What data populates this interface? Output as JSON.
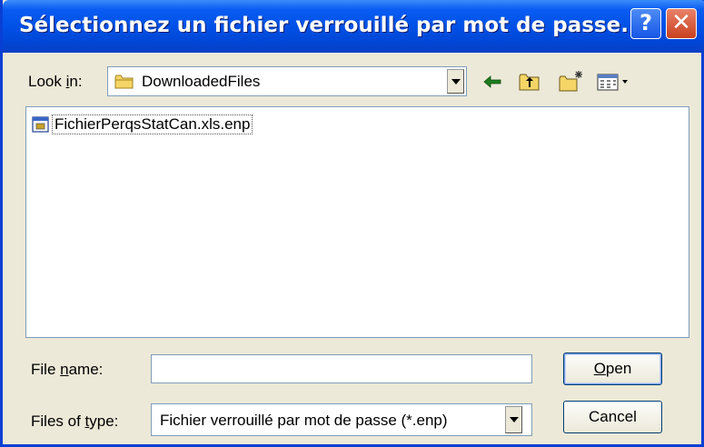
{
  "window": {
    "title": "Sélectionnez un fichier verrouillé par mot de passe.",
    "help_glyph": "?",
    "close_glyph": "✕"
  },
  "look_in": {
    "label": "Look in:",
    "mnemonic_prefix": "Look ",
    "mnemonic_char": "i",
    "mnemonic_suffix": "n:",
    "value": "DownloadedFiles",
    "icon": "folder-icon"
  },
  "toolbar": {
    "icons": [
      "back-arrow-icon",
      "up-one-level-icon",
      "new-folder-icon",
      "view-menu-icon"
    ]
  },
  "files": [
    {
      "name": "FichierPerqsStatCan.xls.enp",
      "icon": "encrypted-file-icon"
    }
  ],
  "file_name": {
    "label_prefix": "File ",
    "label_mnemonic": "n",
    "label_suffix": "ame:",
    "value": ""
  },
  "file_type": {
    "label_prefix": "Files of ",
    "label_mnemonic": "t",
    "label_suffix": "ype:",
    "value": "Fichier verrouillé par mot de passe (*.enp)"
  },
  "buttons": {
    "open_mnemonic": "O",
    "open_rest": "pen",
    "cancel": "Cancel"
  },
  "colors": {
    "titlebar": "#0051e6",
    "window_bg": "#ece9d8",
    "outer_bg": "#fff6a8"
  }
}
